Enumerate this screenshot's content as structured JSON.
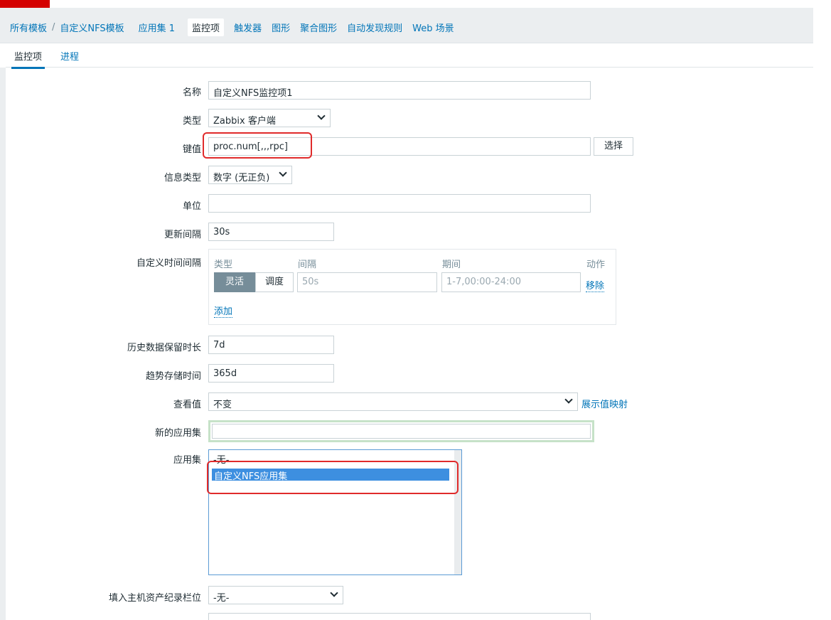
{
  "breadcrumb": {
    "items": [
      "所有模板",
      "自定义NFS模板"
    ],
    "separator": "/",
    "tabs": [
      "应用集 1",
      "监控项",
      "触发器",
      "图形",
      "聚合图形",
      "自动发现规则",
      "Web 场景"
    ]
  },
  "subtabs": {
    "first": "监控项",
    "second": "进程"
  },
  "form": {
    "name": {
      "label": "名称",
      "value": "自定义NFS监控项1"
    },
    "type": {
      "label": "类型",
      "value": "Zabbix 客户端"
    },
    "key": {
      "label": "键值",
      "value": "proc.num[,,,rpc]",
      "select_button": "选择"
    },
    "info_type": {
      "label": "信息类型",
      "value": "数字 (无正负)"
    },
    "units": {
      "label": "单位",
      "value": ""
    },
    "update_interval": {
      "label": "更新间隔",
      "value": "30s"
    },
    "custom_intervals": {
      "label": "自定义时间间隔",
      "col_type": "类型",
      "col_interval": "间隔",
      "col_period": "期间",
      "col_action": "动作",
      "seg_flexible": "灵活",
      "seg_scheduling": "调度",
      "interval_value": "50s",
      "period_value": "1-7,00:00-24:00",
      "remove_link": "移除",
      "add_link": "添加"
    },
    "history": {
      "label": "历史数据保留时长",
      "value": "7d"
    },
    "trends": {
      "label": "趋势存储时间",
      "value": "365d"
    },
    "show_value": {
      "label": "查看值",
      "value": "不变",
      "link": "展示值映射"
    },
    "new_application": {
      "label": "新的应用集",
      "value": ""
    },
    "applications": {
      "label": "应用集",
      "options": [
        "-无-",
        "自定义NFS应用集"
      ]
    },
    "inventory": {
      "label": "填入主机资产纪录栏位",
      "value": "-无-"
    }
  },
  "colors": {
    "accent": "#0275b8",
    "highlight_red": "#e02b2b",
    "selected_option": "#3d8fe0"
  }
}
